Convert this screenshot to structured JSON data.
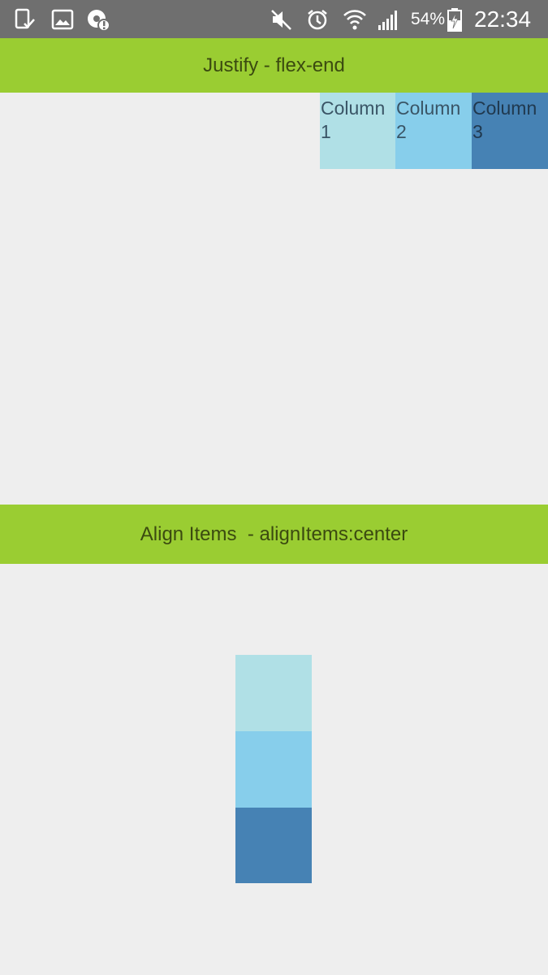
{
  "status_bar": {
    "battery_percent": "54%",
    "time": "22:34",
    "icons": [
      "screenshot-icon",
      "gallery-icon",
      "sync-alert-icon",
      "mute-icon",
      "alarm-icon",
      "wifi-icon",
      "signal-icon",
      "battery-charging-icon"
    ]
  },
  "sections": [
    {
      "title": "Justify - flex-end",
      "columns": [
        "Column 1",
        "Column 2",
        "Column 3"
      ]
    },
    {
      "title": "Align Items  - alignItems:center",
      "columns": [
        "",
        "",
        ""
      ]
    }
  ],
  "colors": {
    "header": "#9acd32",
    "col1": "#b0e0e6",
    "col2": "#87ceeb",
    "col3": "#4682b4",
    "background": "#eeeeee"
  }
}
